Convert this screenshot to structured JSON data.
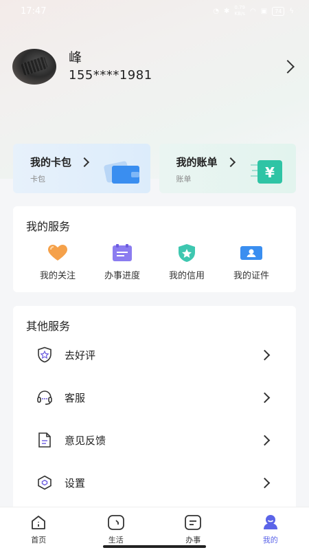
{
  "status_bar": {
    "time": "17:47",
    "net_speed": "0.79\nKB/s",
    "battery": "74"
  },
  "profile": {
    "name": "峰",
    "phone": "155****1981"
  },
  "cards": [
    {
      "title": "我的卡包",
      "subtitle": "卡包",
      "icon": "wallet-icon"
    },
    {
      "title": "我的账单",
      "subtitle": "账单",
      "icon": "bill-icon"
    }
  ],
  "my_services": {
    "title": "我的服务",
    "items": [
      {
        "label": "我的关注",
        "icon": "heart-icon"
      },
      {
        "label": "办事进度",
        "icon": "progress-icon"
      },
      {
        "label": "我的信用",
        "icon": "credit-shield-icon"
      },
      {
        "label": "我的证件",
        "icon": "id-card-icon"
      }
    ]
  },
  "other_services": {
    "title": "其他服务",
    "items": [
      {
        "label": "去好评",
        "icon": "star-shield-icon"
      },
      {
        "label": "客服",
        "icon": "headset-icon"
      },
      {
        "label": "意见反馈",
        "icon": "document-icon"
      },
      {
        "label": "设置",
        "icon": "settings-hexagon-icon"
      }
    ]
  },
  "tabbar": {
    "items": [
      {
        "label": "首页",
        "icon": "home-icon"
      },
      {
        "label": "生活",
        "icon": "life-icon"
      },
      {
        "label": "办事",
        "icon": "affairs-icon"
      },
      {
        "label": "我的",
        "icon": "profile-icon"
      }
    ],
    "active_index": 3
  },
  "colors": {
    "accent": "#5b64e8",
    "wallet_blue": "#3a8ef0",
    "bill_green": "#2fc4a5",
    "heart_orange": "#f5a14a"
  }
}
